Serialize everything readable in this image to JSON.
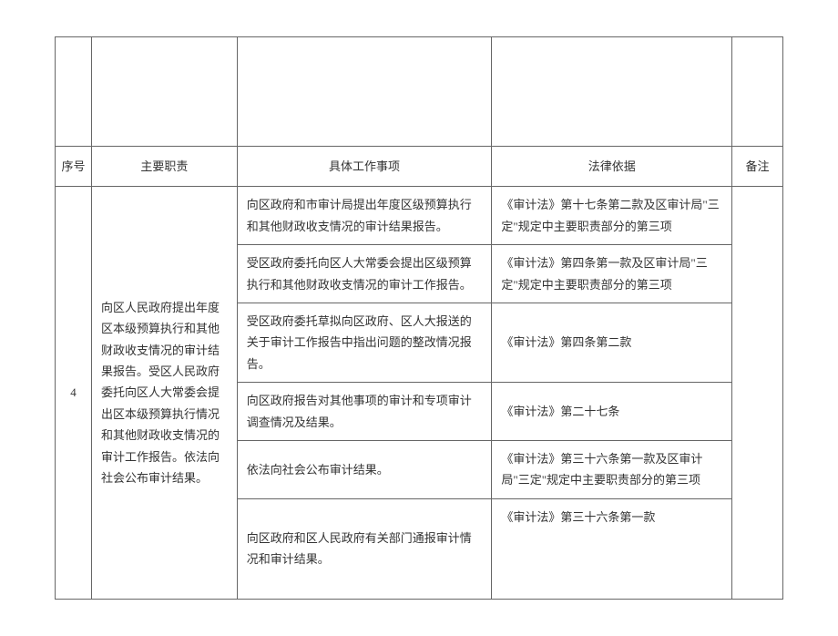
{
  "headers": {
    "num": "序号",
    "responsibility": "主要职责",
    "work": "具体工作事项",
    "legal": "法律依据",
    "note": "备注"
  },
  "row": {
    "num": "4",
    "responsibility": "向区人民政府提出年度区本级预算执行和其他财政收支情况的审计结果报告。受区人民政府委托向区人大常委会提出区本级预算执行情况和其他财政收支情况的审计工作报告。依法向社会公布审计结果。",
    "items": [
      {
        "work": "向区政府和市审计局提出年度区级预算执行和其他财政收支情况的审计结果报告。",
        "legal": "《审计法》第十七条第二款及区审计局\"三定\"规定中主要职责部分的第三项"
      },
      {
        "work": "受区政府委托向区人大常委会提出区级预算执行和其他财政收支情况的审计工作报告。",
        "legal": "《审计法》第四条第一款及区审计局\"三定\"规定中主要职责部分的第三项"
      },
      {
        "work": "受区政府委托草拟向区政府、区人大报送的关于审计工作报告中指出问题的整改情况报告。",
        "legal": "《审计法》第四条第二款"
      },
      {
        "work": "向区政府报告对其他事项的审计和专项审计调查情况及结果。",
        "legal": "《审计法》第二十七条"
      },
      {
        "work": "依法向社会公布审计结果。",
        "legal": "《审计法》第三十六条第一款及区审计局\"三定\"规定中主要职责部分的第三项"
      },
      {
        "work": "向区政府和区人民政府有关部门通报审计情况和审计结果。",
        "legal": "《审计法》第三十六条第一款"
      }
    ]
  }
}
